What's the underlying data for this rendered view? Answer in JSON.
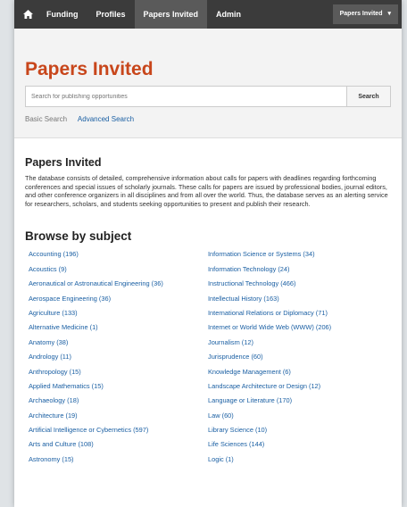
{
  "nav": {
    "items": [
      "Funding",
      "Profiles",
      "Papers Invited",
      "Admin"
    ],
    "dropdown": "Papers Invited"
  },
  "header": {
    "title": "Papers Invited",
    "search_placeholder": "Search for publishing opportunities",
    "search_button": "Search",
    "basic_search": "Basic Search",
    "advanced_search": "Advanced Search"
  },
  "about": {
    "heading": "Papers Invited",
    "text": "The database consists of detailed, comprehensive information about calls for papers with deadlines regarding forthcoming conferences and special issues of scholarly journals. These calls for papers are issued by professional bodies, journal editors, and other conference organizers in all disciplines and from all over the world. Thus, the database serves as an alerting service for researchers, scholars, and students seeking opportunities to present and publish their research."
  },
  "browse": {
    "heading": "Browse by subject",
    "left": [
      "Accounting (196)",
      "Acoustics (9)",
      "Aeronautical or Astronautical Engineering (36)",
      "Aerospace Engineering (36)",
      "Agriculture (133)",
      "Alternative Medicine (1)",
      "Anatomy (38)",
      "Andrology (11)",
      "Anthropology (15)",
      "Applied Mathematics (15)",
      "Archaeology (18)",
      "Architecture (19)",
      "Artificial Intelligence or Cybernetics (597)",
      "Arts and Culture (108)",
      "Astronomy (15)"
    ],
    "right": [
      "Information Science or Systems (34)",
      "Information Technology (24)",
      "Instructional Technology (466)",
      "Intellectual History (163)",
      "International Relations or Diplomacy (71)",
      "Internet or World Wide Web (WWW) (206)",
      "Journalism (12)",
      "Jurisprudence (60)",
      "Knowledge Management (6)",
      "Landscape Architecture or Design (12)",
      "Language or Literature (170)",
      "Law (60)",
      "Library Science (10)",
      "Life Sciences (144)",
      "Logic (1)"
    ]
  }
}
